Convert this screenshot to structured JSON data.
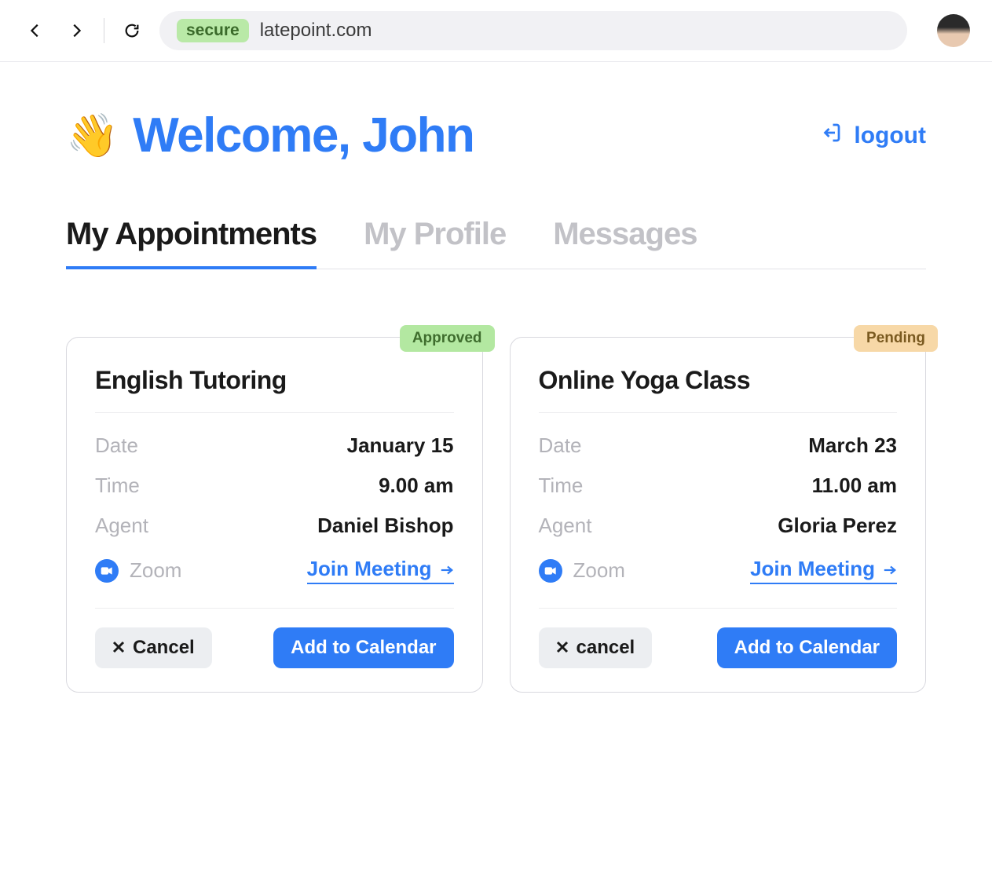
{
  "browser": {
    "secure_label": "secure",
    "url": "latepoint.com"
  },
  "header": {
    "welcome_text": "Welcome, John",
    "wave_emoji": "👋",
    "logout_label": "logout"
  },
  "tabs": [
    {
      "label": "My Appointments",
      "active": true
    },
    {
      "label": "My Profile",
      "active": false
    },
    {
      "label": "Messages",
      "active": false
    }
  ],
  "labels": {
    "date": "Date",
    "time": "Time",
    "agent": "Agent",
    "zoom": "Zoom",
    "join": "Join Meeting",
    "add_to_calendar": "Add to Calendar"
  },
  "appointments": [
    {
      "title": "English Tutoring",
      "status": "Approved",
      "status_kind": "approved",
      "date": "January 15",
      "time": "9.00 am",
      "agent": "Daniel Bishop",
      "cancel_label": "Cancel"
    },
    {
      "title": "Online Yoga Class",
      "status": "Pending",
      "status_kind": "pending",
      "date": "March 23",
      "time": "11.00 am",
      "agent": "Gloria Perez",
      "cancel_label": "cancel"
    }
  ]
}
